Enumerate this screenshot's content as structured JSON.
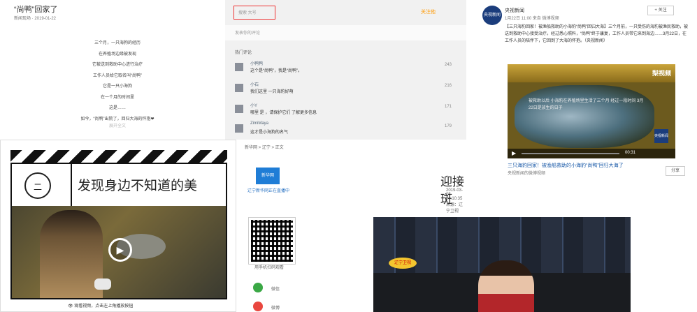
{
  "panel_a": {
    "title": "“尚鸭”回家了",
    "meta": "新闻现场 · 2019-01-22",
    "lines": [
      "三个月，一只海狗的经历",
      "在养殖场边缘被发现",
      "它被送到救助中心进行治疗",
      "工作人员给它取名叫“尚鸭”",
      "它是一只小海狗",
      "在一个月的时间里",
      "这是……",
      "如今，“尚鸭”出院了，回归大海的怀抱❤"
    ],
    "more": "展开全文"
  },
  "panel_b": {
    "search_placeholder": "搜索 大号",
    "follow": "关注他",
    "comment_input": "发表你的评论",
    "hot_label": "热门评论",
    "comments": [
      {
        "name": "小鸭鸭",
        "text": "这个是“尚鸭”，我是“尚鸭”。",
        "likes": "243"
      },
      {
        "name": "小石",
        "text": "我们这里 一只海豹好萌",
        "likes": "216"
      },
      {
        "name": "小Y",
        "text": "哪里 是 ，请保护它们 了解更多信息",
        "likes": "171"
      },
      {
        "name": "ZimiMaya",
        "text": "这才是小海狗的名气",
        "likes": "179"
      }
    ]
  },
  "panel_c": {
    "logo": "央视新闻",
    "account": "央视新闻",
    "time": "1月22日 11:00 来自 微博视频",
    "follow": "+ 关注",
    "body": "【三只海豹回家！被渔船救助的小海豹“尚鸭”回归大海】三个月前，一只受伤的海豹被渔民救助，被送到救助中心接受治疗。经过悉心照料，“尚鸭”终于康复，工作人员带它来到海边……3月22日，在工作人员的陪伴下，它回到了大海的怀抱。（央视新闻）",
    "brand": "梨视频",
    "subtitle": "被救助以后 小海豹在养殖场里生活了三个月 经过一段时间 3月22日是放生的日子",
    "duration": "00:31",
    "badge": "央视新闻",
    "link": "三只海豹回家！被渔船救助的小海豹“尚鸭”回归大海了",
    "views": "央视新闻的微博视频",
    "share": "分享"
  },
  "panel_d": {
    "logo_char": "二",
    "headline": "发现身边不知道的美",
    "hint": "👁 观看视频，点击左上角播放按钮"
  },
  "panel_e": {
    "breadcrumb": "新华网 > 辽宁 > 正文",
    "logo": "新华网",
    "site": "辽宁新华网正在直播中",
    "qr_caption": "用手机扫码观看",
    "share_wechat": "微信",
    "share_weibo": "微博",
    "headline": "迎接斑",
    "datetime": "2019-03-05 09:10:35    来源：辽宁卫视"
  },
  "news_video": {
    "caption": "辽宁卫视"
  }
}
